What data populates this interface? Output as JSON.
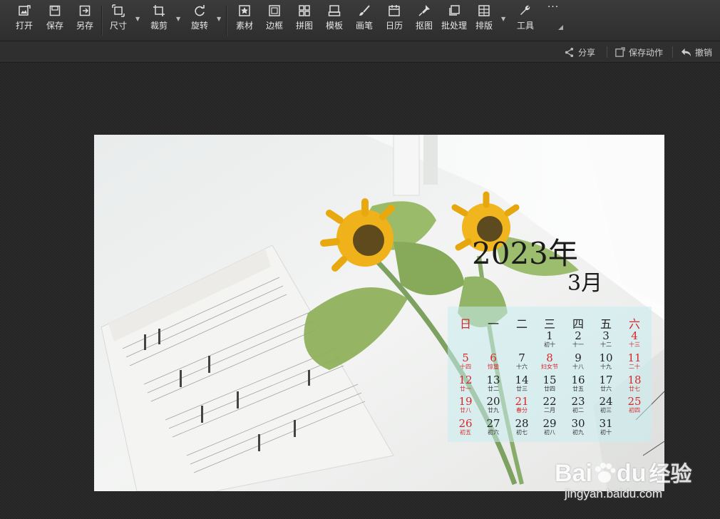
{
  "toolbar": {
    "tools": [
      {
        "label": "打开",
        "icon": "open-image-icon"
      },
      {
        "label": "保存",
        "icon": "save-icon"
      },
      {
        "label": "另存",
        "icon": "save-as-icon"
      },
      {
        "label": "尺寸",
        "icon": "resize-icon"
      },
      {
        "label": "裁剪",
        "icon": "crop-icon"
      },
      {
        "label": "旋转",
        "icon": "rotate-icon"
      },
      {
        "label": "素材",
        "icon": "sticker-icon"
      },
      {
        "label": "边框",
        "icon": "frame-icon"
      },
      {
        "label": "拼图",
        "icon": "collage-icon"
      },
      {
        "label": "模板",
        "icon": "template-icon"
      },
      {
        "label": "画笔",
        "icon": "brush-icon"
      },
      {
        "label": "日历",
        "icon": "calendar-icon"
      },
      {
        "label": "抠图",
        "icon": "cutout-icon"
      },
      {
        "label": "批处理",
        "icon": "batch-icon"
      },
      {
        "label": "排版",
        "icon": "layout-icon"
      },
      {
        "label": "工具",
        "icon": "wrench-icon"
      }
    ],
    "more": "···"
  },
  "subbar": {
    "share": "分享",
    "save_action": "保存动作",
    "undo": "撤销"
  },
  "calendar": {
    "year": "2023年",
    "month": "3月",
    "weekdays": [
      "日",
      "一",
      "二",
      "三",
      "四",
      "五",
      "六"
    ],
    "rows": [
      [
        null,
        null,
        null,
        {
          "d": "1",
          "l": "初十"
        },
        {
          "d": "2",
          "l": "十一"
        },
        {
          "d": "3",
          "l": "十二"
        },
        {
          "d": "4",
          "l": "十三"
        }
      ],
      [
        {
          "d": "5",
          "l": "十四"
        },
        {
          "d": "6",
          "l": "惊蛰"
        },
        {
          "d": "7",
          "l": "十六"
        },
        {
          "d": "8",
          "l": "妇女节"
        },
        {
          "d": "9",
          "l": "十八"
        },
        {
          "d": "10",
          "l": "十九"
        },
        {
          "d": "11",
          "l": "二十"
        }
      ],
      [
        {
          "d": "12",
          "l": "廿一"
        },
        {
          "d": "13",
          "l": "廿二"
        },
        {
          "d": "14",
          "l": "廿三"
        },
        {
          "d": "15",
          "l": "廿四"
        },
        {
          "d": "16",
          "l": "廿五"
        },
        {
          "d": "17",
          "l": "廿六"
        },
        {
          "d": "18",
          "l": "廿七"
        }
      ],
      [
        {
          "d": "19",
          "l": "廿八"
        },
        {
          "d": "20",
          "l": "廿九"
        },
        {
          "d": "21",
          "l": "春分"
        },
        {
          "d": "22",
          "l": "二月"
        },
        {
          "d": "23",
          "l": "初二"
        },
        {
          "d": "24",
          "l": "初三"
        },
        {
          "d": "25",
          "l": "初四"
        }
      ],
      [
        {
          "d": "26",
          "l": "初五"
        },
        {
          "d": "27",
          "l": "初六"
        },
        {
          "d": "28",
          "l": "初七"
        },
        {
          "d": "29",
          "l": "初八"
        },
        {
          "d": "30",
          "l": "初九"
        },
        {
          "d": "31",
          "l": "初十"
        }
      ]
    ],
    "red_dates": [
      "4",
      "5",
      "6",
      "8",
      "11",
      "12",
      "18",
      "19",
      "21",
      "25",
      "26"
    ]
  },
  "watermark": {
    "brand": "Bai",
    "brand2": "du",
    "cn": "经验",
    "url": "jingyan.baidu.com"
  },
  "colors": {
    "accent_red": "#d9282a",
    "toolbar_bg": "#333333",
    "canvas_bg": "#262626"
  }
}
